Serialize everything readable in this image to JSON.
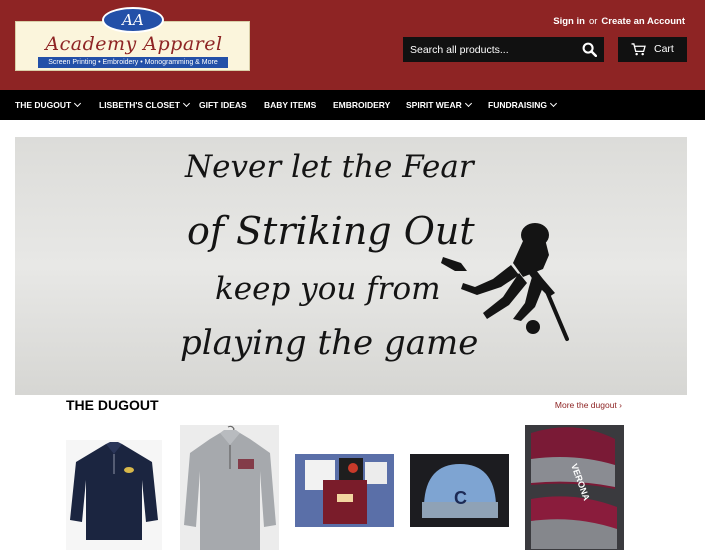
{
  "brand": {
    "monogram": "AA",
    "name": "Academy Apparel",
    "tagline": "Screen Printing • Embroidery • Monogramming & More"
  },
  "header": {
    "sign_in": "Sign in",
    "or": "or",
    "create_account": "Create an Account",
    "search_placeholder": "Search all products...",
    "cart_label": "Cart"
  },
  "nav": {
    "items": [
      {
        "label": "THE DUGOUT",
        "dropdown": true
      },
      {
        "label": "LISBETH'S CLOSET",
        "dropdown": true
      },
      {
        "label": "GIFT IDEAS",
        "dropdown": false
      },
      {
        "label": "BABY ITEMS",
        "dropdown": false
      },
      {
        "label": "EMBROIDERY",
        "dropdown": false
      },
      {
        "label": "SPIRIT WEAR",
        "dropdown": true
      },
      {
        "label": "FUNDRAISING",
        "dropdown": true
      }
    ]
  },
  "hero": {
    "lines": [
      "Never let the Fear",
      "of Striking Out",
      "keep you from",
      "playing the game"
    ]
  },
  "section": {
    "title": "THE DUGOUT",
    "more_link": "More the dugout ›"
  },
  "colors": {
    "header_bg": "#8e2424",
    "nav_bg": "#000000",
    "accent_link": "#8e2424"
  }
}
